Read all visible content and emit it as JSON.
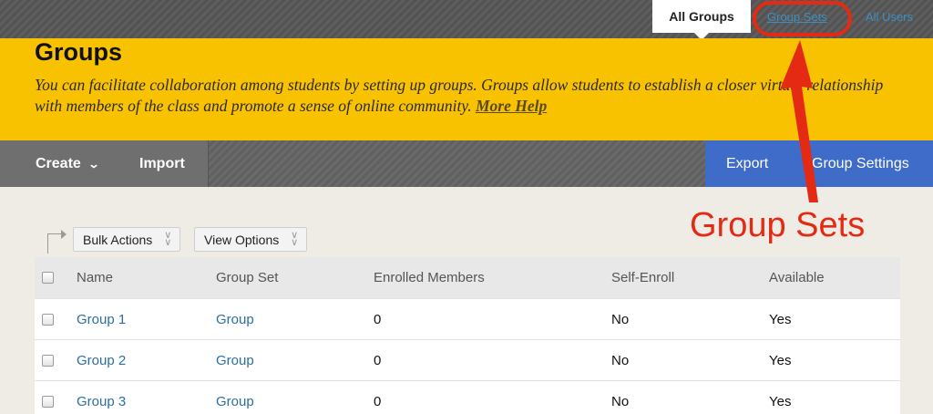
{
  "tabs": {
    "all_groups": "All Groups",
    "group_sets": "Group Sets",
    "all_users": "All Users"
  },
  "header": {
    "title": "Groups",
    "description": "You can facilitate collaboration among students by setting up groups. Groups allow students to establish a closer virtual relationship with members of the class and promote a sense of online community.",
    "more_help": "More Help"
  },
  "actionbar": {
    "create": "Create",
    "import": "Import",
    "export": "Export",
    "group_settings": "Group Settings"
  },
  "bulk": {
    "bulk_actions": "Bulk Actions",
    "view_options": "View Options"
  },
  "table": {
    "columns": [
      "Name",
      "Group Set",
      "Enrolled Members",
      "Self-Enroll",
      "Available"
    ],
    "rows": [
      {
        "name": "Group 1",
        "group_set": "Group",
        "enrolled": "0",
        "self_enroll": "No",
        "available": "Yes"
      },
      {
        "name": "Group 2",
        "group_set": "Group",
        "enrolled": "0",
        "self_enroll": "No",
        "available": "Yes"
      },
      {
        "name": "Group 3",
        "group_set": "Group",
        "enrolled": "0",
        "self_enroll": "No",
        "available": "Yes"
      }
    ]
  },
  "annotation": {
    "label": "Group Sets",
    "color": "#e42a12"
  },
  "colors": {
    "header_yellow": "#f9c200",
    "action_blue": "#3f6bc9",
    "link_blue": "#2c6f9e"
  }
}
